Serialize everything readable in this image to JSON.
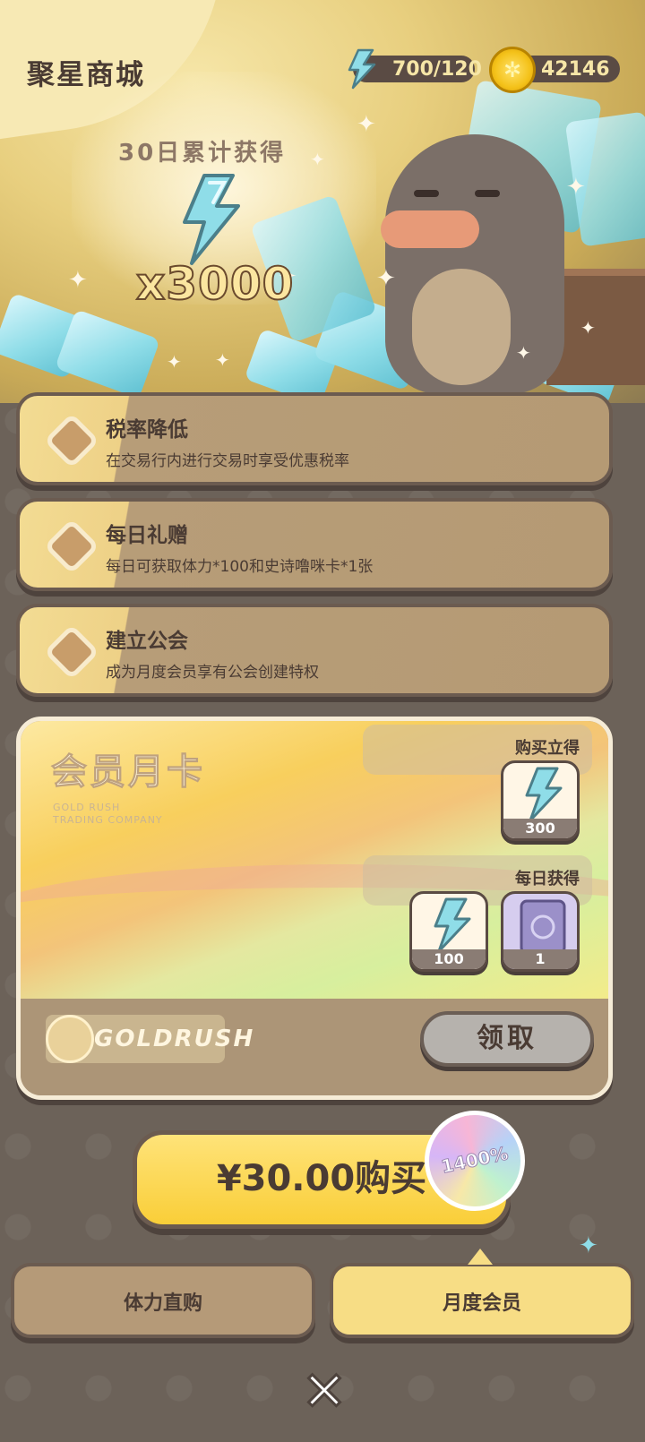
{
  "header": {
    "title": "聚星商城",
    "energy": "700/120",
    "coins": "42146"
  },
  "hero": {
    "accumulate_label": "30日累计获得",
    "accumulate_count": "x3000"
  },
  "perks": [
    {
      "title": "税率降低",
      "desc": "在交易行内进行交易时享受优惠税率"
    },
    {
      "title": "每日礼赠",
      "desc": "每日可获取体力*100和史诗噜咪卡*1张"
    },
    {
      "title": "建立公会",
      "desc": "成为月度会员享有公会创建特权"
    }
  ],
  "member_card": {
    "title": "会员月卡",
    "logo_lines": [
      "GOLD RUSH",
      "TRADING COMPANY"
    ],
    "instant_label": "购买立得",
    "instant_items": [
      {
        "icon": "energy-bolt-icon",
        "count": "300"
      }
    ],
    "daily_label": "每日获得",
    "daily_items": [
      {
        "icon": "energy-bolt-icon",
        "count": "100"
      },
      {
        "icon": "card-icon",
        "count": "1"
      }
    ],
    "brand": "GOLDRUSH",
    "claim_label": "领取"
  },
  "purchase": {
    "label": "¥30.00购买",
    "badge": "1400%"
  },
  "tabs": [
    {
      "label": "体力直购"
    },
    {
      "label": "月度会员"
    }
  ],
  "colors": {
    "accent": "#f9ce38",
    "energy": "#7fd8e6",
    "background": "#6c6259"
  }
}
